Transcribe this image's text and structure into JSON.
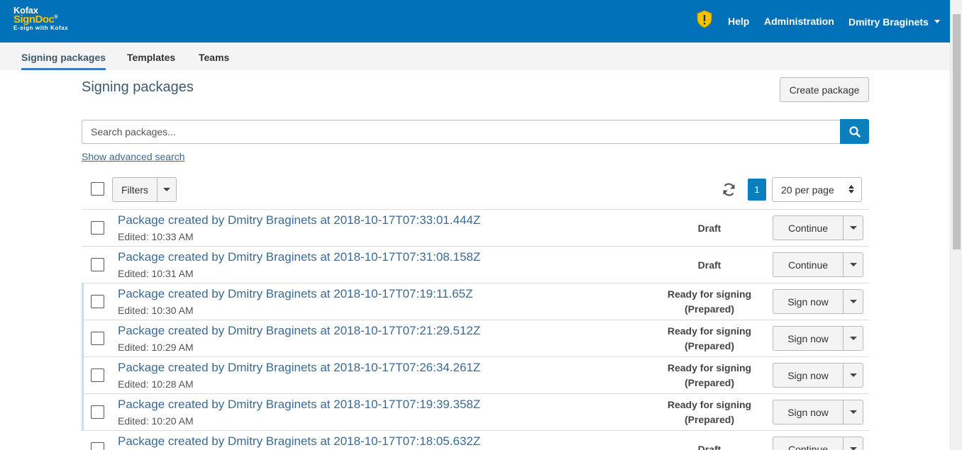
{
  "header": {
    "logo": {
      "line1": "Kofax",
      "line2": "SignDoc",
      "trademark": "®",
      "line3": "E-sign with Kofax"
    },
    "help": "Help",
    "administration": "Administration",
    "user": "Dmitry Braginets",
    "brand_color": "#0070b8",
    "accent_color": "#f5c400"
  },
  "tabs": [
    {
      "label": "Signing packages",
      "active": true
    },
    {
      "label": "Templates",
      "active": false
    },
    {
      "label": "Teams",
      "active": false
    }
  ],
  "main": {
    "title": "Signing packages",
    "create_button": "Create package",
    "search_placeholder": "Search packages...",
    "advanced_search": "Show advanced search",
    "filters_label": "Filters",
    "current_page": "1",
    "per_page": "20 per page"
  },
  "packages": [
    {
      "title": "Package created by Dmitry Braginets at 2018-10-17T07:33:01.444Z",
      "edited": "Edited: 10:33 AM",
      "status1": "Draft",
      "status2": "",
      "action": "Continue",
      "ready": false
    },
    {
      "title": "Package created by Dmitry Braginets at 2018-10-17T07:31:08.158Z",
      "edited": "Edited: 10:31 AM",
      "status1": "Draft",
      "status2": "",
      "action": "Continue",
      "ready": false
    },
    {
      "title": "Package created by Dmitry Braginets at 2018-10-17T07:19:11.65Z",
      "edited": "Edited: 10:30 AM",
      "status1": "Ready for signing",
      "status2": "(Prepared)",
      "action": "Sign now",
      "ready": true
    },
    {
      "title": "Package created by Dmitry Braginets at 2018-10-17T07:21:29.512Z",
      "edited": "Edited: 10:29 AM",
      "status1": "Ready for signing",
      "status2": "(Prepared)",
      "action": "Sign now",
      "ready": true
    },
    {
      "title": "Package created by Dmitry Braginets at 2018-10-17T07:26:34.261Z",
      "edited": "Edited: 10:28 AM",
      "status1": "Ready for signing",
      "status2": "(Prepared)",
      "action": "Sign now",
      "ready": true
    },
    {
      "title": "Package created by Dmitry Braginets at 2018-10-17T07:19:39.358Z",
      "edited": "Edited: 10:20 AM",
      "status1": "Ready for signing",
      "status2": "(Prepared)",
      "action": "Sign now",
      "ready": true
    },
    {
      "title": "Package created by Dmitry Braginets at 2018-10-17T07:18:05.632Z",
      "edited": "",
      "status1": "Draft",
      "status2": "",
      "action": "Continue",
      "ready": false
    }
  ]
}
